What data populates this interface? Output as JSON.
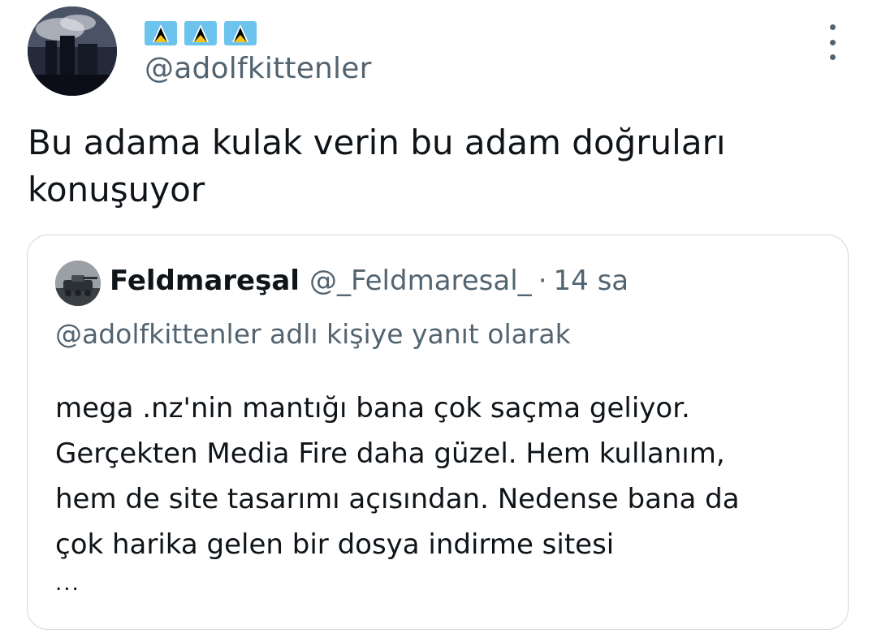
{
  "tweet": {
    "handle": "@adolfkittenler",
    "text": "Bu adama kulak verin bu adam doğruları\nkonuşuyor",
    "flag_icons": [
      "saint-lucia-flag-icon",
      "saint-lucia-flag-icon",
      "saint-lucia-flag-icon"
    ]
  },
  "quote": {
    "name": "Feldmareşal",
    "handle": "@_Feldmaresal_",
    "separator": "·",
    "time": "14 sa",
    "reply_to": "@adolfkittenler adlı kişiye yanıt olarak",
    "text": "mega .nz'nin mantığı bana çok saçma geliyor.\nGerçekten Media Fire daha güzel. Hem kullanım,\nhem de site tasarımı açısından. Nedense bana da\nçok harika gelen bir dosya indirme sitesi",
    "ellipsis": "..."
  },
  "colors": {
    "text_primary": "#0f1419",
    "text_secondary": "#536471",
    "border": "#cfd9de",
    "flag_blue": "#6cc4ee",
    "flag_yellow": "#f5c518"
  }
}
